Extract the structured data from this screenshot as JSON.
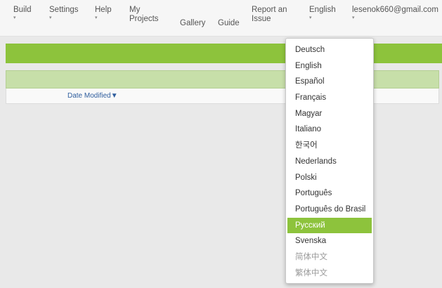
{
  "nav": {
    "build": "Build",
    "settings": "Settings",
    "help": "Help",
    "my_projects": "My Projects",
    "gallery": "Gallery",
    "guide": "Guide",
    "report_issue": "Report an Issue",
    "language": "English",
    "account": "lesenok660@gmail.com",
    "caret": "▾"
  },
  "table": {
    "date_modified_header": "Date Modified▼"
  },
  "language_menu": {
    "items": [
      "Deutsch",
      "English",
      "Español",
      "Français",
      "Magyar",
      "Italiano",
      "한국어",
      "Nederlands",
      "Polski",
      "Português",
      "Português do Brasil",
      "Русский",
      "Svenska",
      "简体中文",
      "繁体中文"
    ],
    "selected_index": 11
  },
  "colors": {
    "accent_green": "#8dc33c",
    "light_green": "#c7dfa9",
    "link_blue": "#2f5e9e"
  }
}
